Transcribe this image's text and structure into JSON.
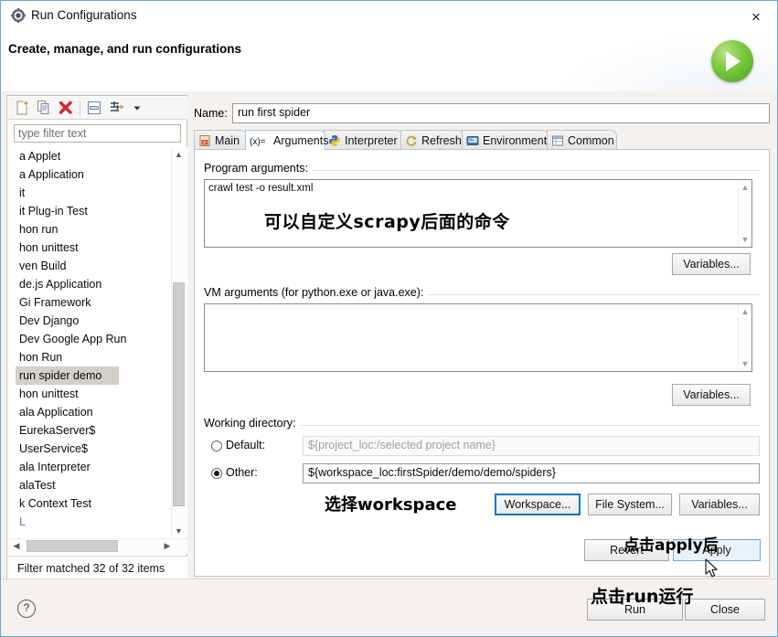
{
  "window": {
    "title": "Run Configurations",
    "subtitle": "Create, manage, and run configurations",
    "close_label": "×",
    "run_badge_name": "run-launch-icon",
    "accent_blue": "#1076c6",
    "selection_gray": "#d4d0c8"
  },
  "toolbar": {
    "buttons": [
      {
        "name": "new-launch-configuration-icon",
        "tooltip": "New launch configuration"
      },
      {
        "name": "duplicate-icon",
        "tooltip": "Duplicate"
      },
      {
        "name": "delete-icon",
        "tooltip": "Delete"
      },
      {
        "name": "collapse-all-icon",
        "tooltip": "Collapse All"
      },
      {
        "name": "filter-icon",
        "tooltip": "Filter launch configurations"
      },
      {
        "name": "chevron-down-icon",
        "tooltip": "View Menu"
      }
    ]
  },
  "filter": {
    "placeholder": "type filter text",
    "value": "",
    "status": "Filter matched 32 of 32 items"
  },
  "tree": {
    "items": [
      {
        "label": "a Applet",
        "selected": false
      },
      {
        "label": "a Application",
        "selected": false
      },
      {
        "label": "it",
        "selected": false
      },
      {
        "label": "it Plug-in Test",
        "selected": false
      },
      {
        "label": "hon run",
        "selected": false
      },
      {
        "label": "hon unittest",
        "selected": false
      },
      {
        "label": "ven Build",
        "selected": false
      },
      {
        "label": "de.js Application",
        "selected": false
      },
      {
        "label": "Gi Framework",
        "selected": false
      },
      {
        "label": "Dev Django",
        "selected": false
      },
      {
        "label": "Dev Google App Run",
        "selected": false
      },
      {
        "label": "hon Run",
        "selected": false
      },
      {
        "label": "run spider demo",
        "selected": true
      },
      {
        "label": "hon unittest",
        "selected": false
      },
      {
        "label": "ala Application",
        "selected": false
      },
      {
        "label": "EurekaServer$",
        "selected": false
      },
      {
        "label": "UserService$",
        "selected": false
      },
      {
        "label": "ala Interpreter",
        "selected": false
      },
      {
        "label": "alaTest",
        "selected": false
      },
      {
        "label": "k Context Test",
        "selected": false
      },
      {
        "label": "L",
        "selected": false
      }
    ]
  },
  "config": {
    "name_label": "Name:",
    "name_value": "run first spider"
  },
  "tabs": [
    {
      "label": "Main",
      "icon": "python-module-icon",
      "active": false
    },
    {
      "label": "Arguments",
      "icon": "variable-icon",
      "active": true
    },
    {
      "label": "Interpreter",
      "icon": "python-icon",
      "active": false
    },
    {
      "label": "Refresh",
      "icon": "refresh-icon",
      "active": false
    },
    {
      "label": "Environment",
      "icon": "environment-icon",
      "active": false
    },
    {
      "label": "Common",
      "icon": "common-icon",
      "active": false
    }
  ],
  "arguments": {
    "program_args_label": "Program arguments:",
    "program_args_value": "crawl test -o result.xml",
    "program_args_variables_button": "Variables...",
    "vm_args_label": "VM arguments (for python.exe or java.exe):",
    "vm_args_value": "",
    "vm_args_variables_button": "Variables..."
  },
  "working_directory": {
    "label": "Working directory:",
    "default_radio_label": "Default:",
    "default_value": "${project_loc:/selected project name}",
    "default_selected": false,
    "other_radio_label": "Other:",
    "other_value": "${workspace_loc:firstSpider/demo/demo/spiders}",
    "other_selected": true,
    "workspace_button": "Workspace...",
    "file_system_button": "File System...",
    "variables_button": "Variables..."
  },
  "footer": {
    "revert_button": "Revert",
    "apply_button": "Apply",
    "run_button": "Run",
    "close_button": "Close",
    "help_icon_label": "?"
  },
  "annotations": [
    {
      "text": "可以自定义scrapy后面的命令",
      "name": "annotation-program-arguments"
    },
    {
      "text": "选择workspace",
      "name": "annotation-workspace"
    },
    {
      "text": "点击apply后",
      "name": "annotation-apply"
    },
    {
      "text": "点击run运行",
      "name": "annotation-run"
    }
  ]
}
